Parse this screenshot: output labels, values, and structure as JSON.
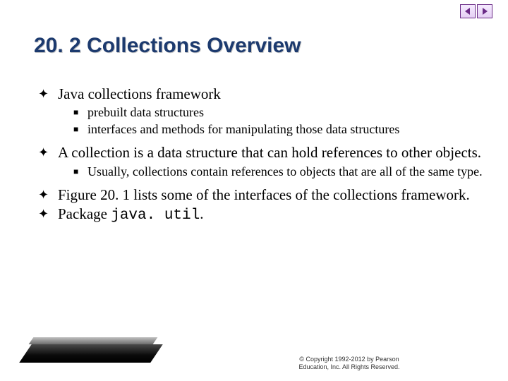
{
  "slide": {
    "title": "20. 2  Collections Overview"
  },
  "nav": {
    "prev_icon_name": "arrow-left-icon",
    "next_icon_name": "arrow-right-icon"
  },
  "bullets": {
    "b1": "Java collections framework",
    "b1_1": "prebuilt data structures",
    "b1_2": "interfaces and methods for manipulating those data structures",
    "b2": "A collection is a data structure that can hold references to other objects.",
    "b2_1": "Usually, collections contain references to objects that are all of the same type.",
    "b3": "Figure 20. 1 lists some of the interfaces of the collections framework.",
    "b4_pre": "Package ",
    "b4_code": "java. util",
    "b4_post": "."
  },
  "footer": {
    "copyright_line1": "© Copyright 1992-2012 by Pearson",
    "copyright_line2": "Education, Inc. All Rights Reserved."
  },
  "colors": {
    "title": "#1c3a6e",
    "nav_border": "#6a2a86"
  }
}
